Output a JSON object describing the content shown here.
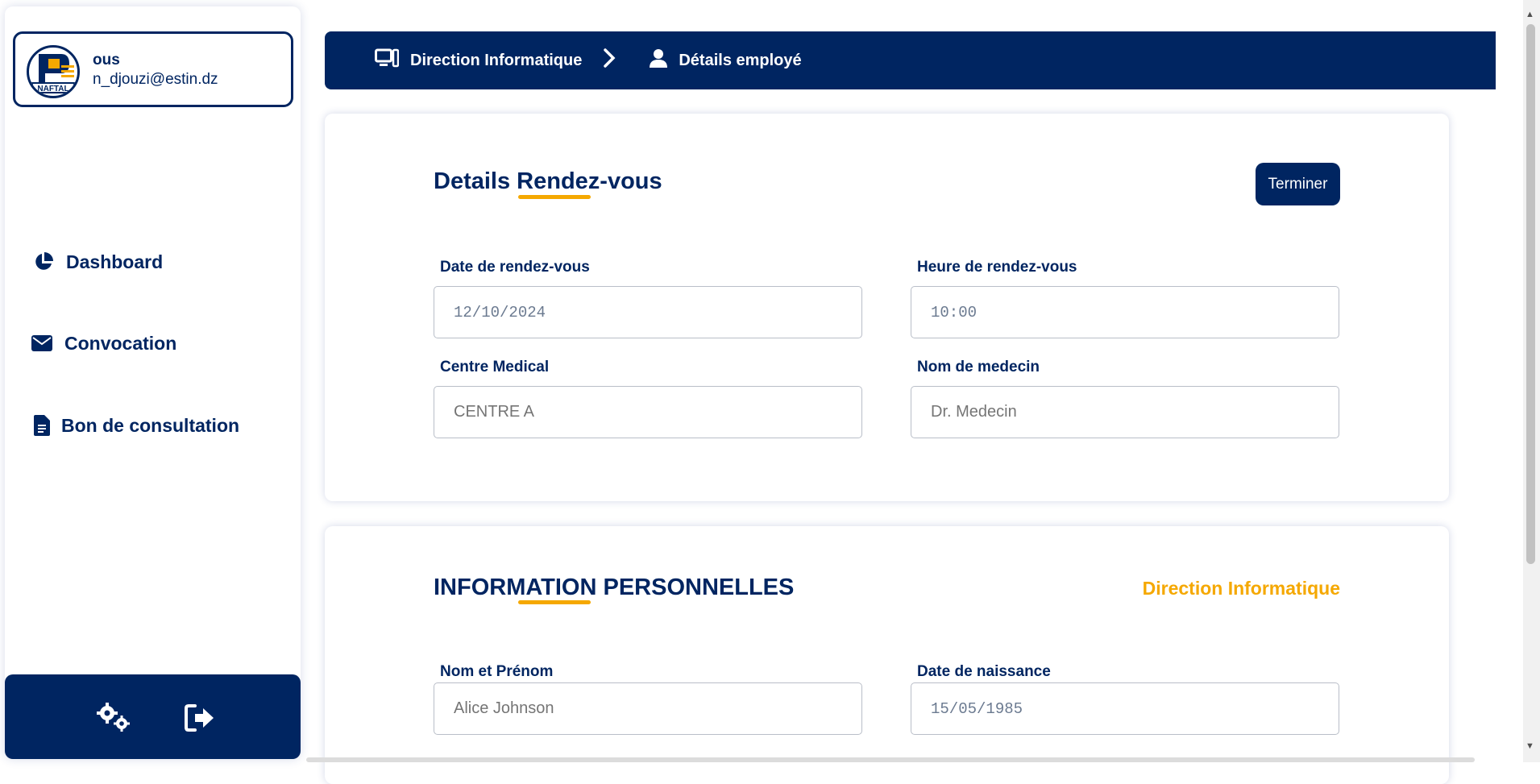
{
  "profile": {
    "name": "ous",
    "email": "n_djouzi@estin.dz",
    "logo_text": "NAFTAL"
  },
  "nav": {
    "dashboard": "Dashboard",
    "convocation": "Convocation",
    "bon": "Bon de consultation"
  },
  "breadcrumb": {
    "department": "Direction Informatique",
    "page": "Détails employé"
  },
  "appointment": {
    "title_a": "Details ",
    "title_b": "Rendez-vous",
    "finish_button": "Terminer",
    "date_label": "Date de rendez-vous",
    "date_value": "12/10/2024",
    "time_label": "Heure de rendez-vous",
    "time_value": "10:00",
    "centre_label": "Centre Medical",
    "centre_placeholder": "CENTRE A",
    "doctor_label": "Nom de medecin",
    "doctor_placeholder": "Dr. Medecin"
  },
  "personal": {
    "title": "INFORMATION PERSONNELLES",
    "department": "Direction Informatique",
    "name_label": "Nom et Prénom",
    "name_placeholder": "Alice Johnson",
    "birth_label": "Date de naissance",
    "birth_value": "15/05/1985"
  },
  "colors": {
    "primary": "#002561",
    "accent": "#F5A800"
  }
}
